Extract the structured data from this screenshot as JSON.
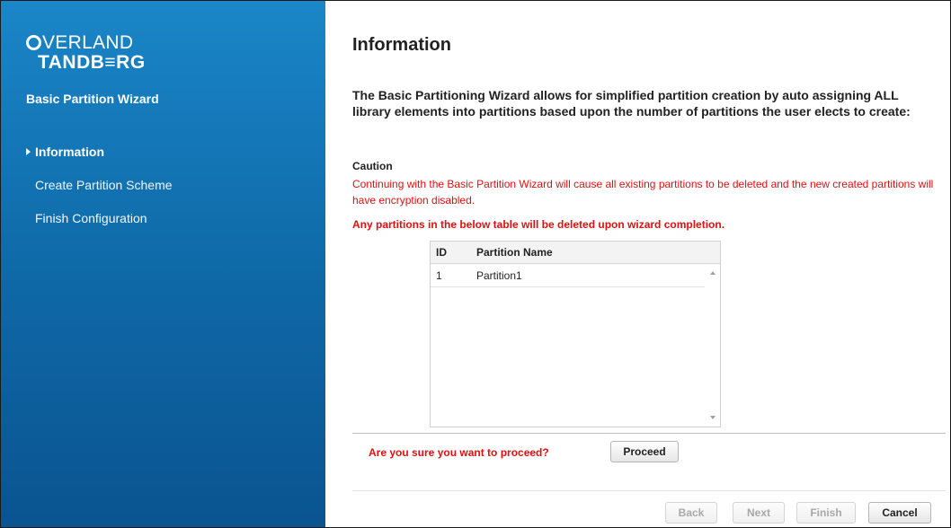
{
  "brand": {
    "line1": "VERLAND",
    "line2": "TANDB≡RG"
  },
  "sidebar": {
    "title": "Basic Partition Wizard",
    "items": [
      {
        "label": "Information",
        "active": true
      },
      {
        "label": "Create Partition Scheme",
        "active": false
      },
      {
        "label": "Finish Configuration",
        "active": false
      }
    ]
  },
  "main": {
    "heading": "Information",
    "intro": "The Basic Partitioning Wizard allows for simplified partition creation by auto assigning ALL library elements into partitions based upon the number of partitions the user elects to create:",
    "caution_label": "Caution",
    "caution_text": "Continuing with the Basic Partition Wizard will cause all existing partitions to be deleted and the new created partitions will have encryption disabled.",
    "warning": "Any partitions in the below table will be deleted upon wizard completion.",
    "table": {
      "columns": [
        "ID",
        "Partition Name"
      ],
      "rows": [
        {
          "id": "1",
          "name": "Partition1"
        }
      ]
    },
    "proceed_question": "Are you sure you want to proceed?",
    "proceed_label": "Proceed"
  },
  "footer": {
    "back_label": "Back",
    "next_label": "Next",
    "finish_label": "Finish",
    "cancel_label": "Cancel"
  },
  "colors": {
    "sidebar_blue": "#0f6aa8",
    "warning_red": "#e01010"
  }
}
